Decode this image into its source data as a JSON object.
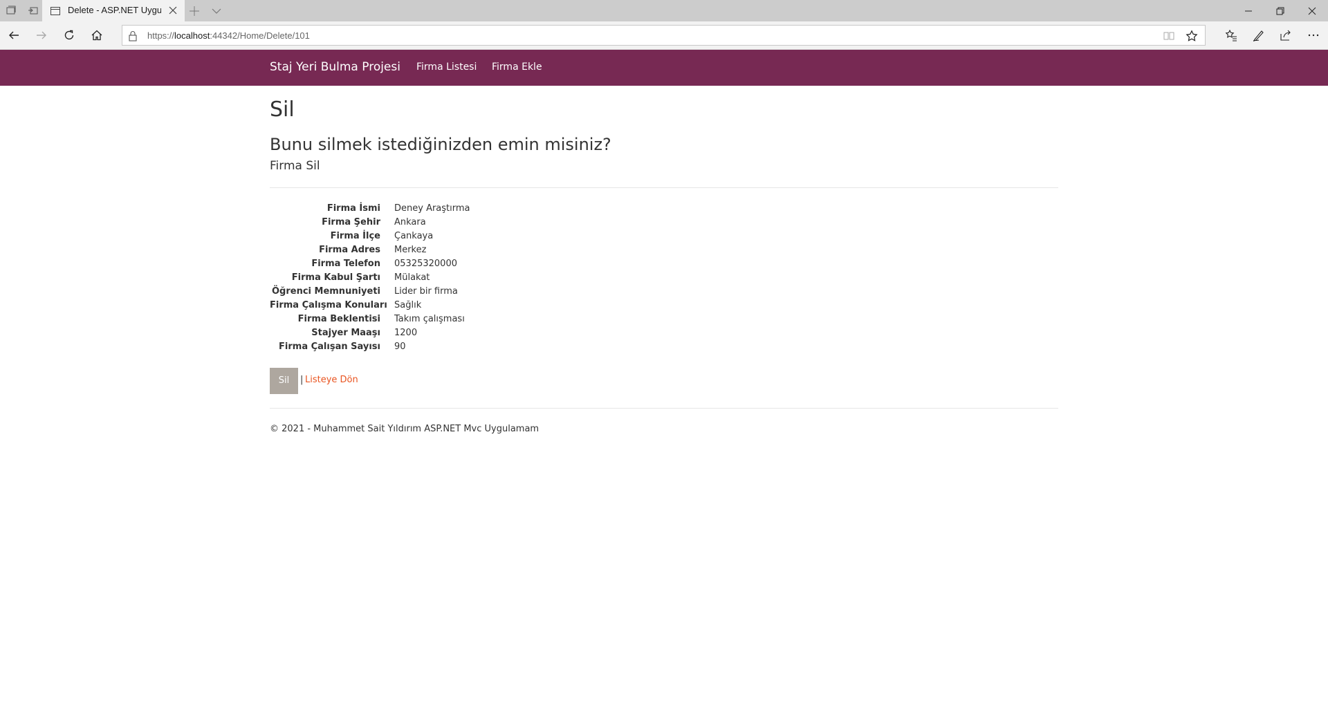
{
  "browser": {
    "tab_title": "Delete - ASP.NET Uygul",
    "url_prefix": "https://",
    "url_host": "localhost",
    "url_rest": ":44342/Home/Delete/101"
  },
  "site": {
    "brand": "Staj Yeri Bulma Projesi",
    "nav": [
      "Firma Listesi",
      "Firma Ekle"
    ]
  },
  "page": {
    "title": "Sil",
    "confirm": "Bunu silmek istediğinizden emin misiniz?",
    "subtitle": "Firma Sil",
    "fields": [
      {
        "label": "Firma İsmi",
        "value": "Deney Araştırma"
      },
      {
        "label": "Firma Şehir",
        "value": "Ankara"
      },
      {
        "label": "Firma İlçe",
        "value": "Çankaya"
      },
      {
        "label": "Firma Adres",
        "value": "Merkez"
      },
      {
        "label": "Firma Telefon",
        "value": "05325320000"
      },
      {
        "label": "Firma Kabul Şartı",
        "value": "Mülakat"
      },
      {
        "label": "Öğrenci Memnuniyeti",
        "value": "Lider bir firma"
      },
      {
        "label": "Firma Çalışma Konuları",
        "value": "Sağlık"
      },
      {
        "label": "Firma Beklentisi",
        "value": "Takım çalışması"
      },
      {
        "label": "Stajyer Maaşı",
        "value": "1200"
      },
      {
        "label": "Firma Çalışan Sayısı",
        "value": "90"
      }
    ],
    "delete_button": "Sil",
    "separator": "|",
    "back_link": "Listeye Dön"
  },
  "footer": {
    "text": "© 2021 - Muhammet Sait Yıldırım ASP.NET Mvc Uygulamam"
  },
  "colors": {
    "navbar": "#772953",
    "button": "#aea79f",
    "link": "#e95420"
  }
}
